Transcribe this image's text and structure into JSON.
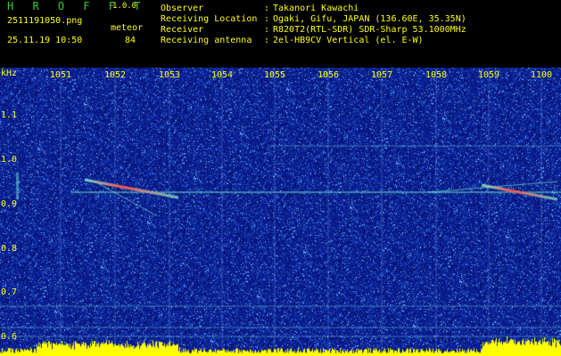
{
  "app": {
    "name": "H R O F F T",
    "version": "1.0.0"
  },
  "file": {
    "name": "2511191050.png",
    "datetime": "25.11.19 10:50"
  },
  "detection": {
    "label": "meteor",
    "count": "84"
  },
  "station": {
    "rows": [
      {
        "key": "Observer",
        "value": "Takanori Kawachi"
      },
      {
        "key": "Receiving Location",
        "value": "Ogaki, Gifu, JAPAN (136.60E, 35.35N)"
      },
      {
        "key": "Receiver",
        "value": "R820T2(RTL-SDR) SDR-Sharp 53.1000MHz"
      },
      {
        "key": "Receiving antenna",
        "value": "2el-HB9CV Vertical (el. E-W)"
      }
    ]
  },
  "axis": {
    "unit": "kHz",
    "y_ticks": [
      "1.1",
      "1.0",
      "0.9",
      "0.8",
      "0.7",
      "0.6"
    ],
    "x_ticks": [
      "1051",
      "1052",
      "1053",
      "1054",
      "1055",
      "1056",
      "1057",
      "1058",
      "1059",
      "1100"
    ]
  },
  "colors": {
    "label": "#ffff00",
    "brand": "#33cc33",
    "background": "#0a1a8c",
    "carrier": "#66e0c0"
  }
}
